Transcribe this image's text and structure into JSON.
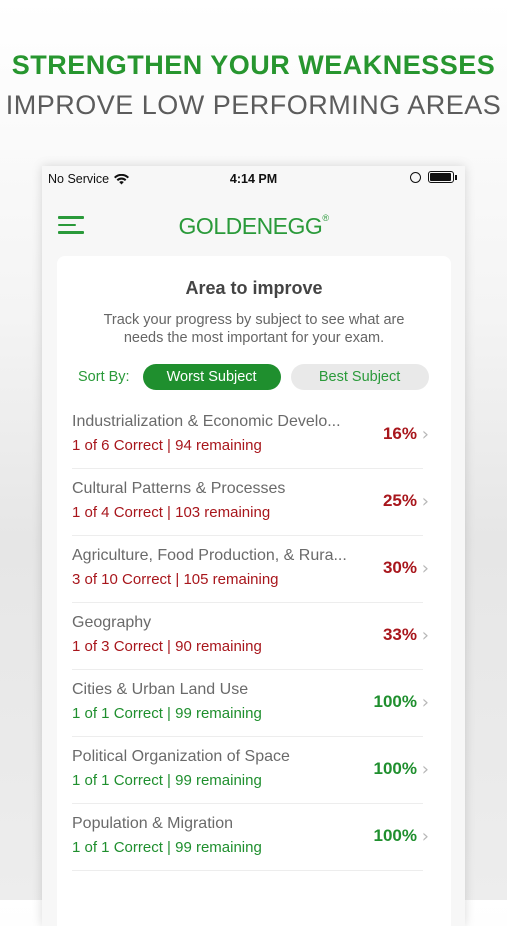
{
  "promo": {
    "title": "STRENGTHEN YOUR WEAKNESSES",
    "subtitle": "IMPROVE LOW PERFORMING AREAS"
  },
  "status_bar": {
    "carrier": "No Service",
    "time": "4:14 PM"
  },
  "header": {
    "logo": "GOLDENEGG",
    "logo_mark": "®"
  },
  "card": {
    "title": "Area to improve",
    "description": "Track your progress by subject to see what are needs the most important for your exam.",
    "sort_label": "Sort By:",
    "sort_worst": "Worst Subject",
    "sort_best": "Best Subject"
  },
  "subjects": [
    {
      "name": "Industrialization & Economic Develo...",
      "meta": "1 of 6  Correct | 94 remaining",
      "percent": "16%",
      "status": "red"
    },
    {
      "name": "Cultural Patterns & Processes",
      "meta": "1 of 4  Correct | 103 remaining",
      "percent": "25%",
      "status": "red"
    },
    {
      "name": "Agriculture, Food Production, & Rura...",
      "meta": "3 of 10  Correct | 105 remaining",
      "percent": "30%",
      "status": "red"
    },
    {
      "name": "Geography",
      "meta": "1 of 3  Correct | 90 remaining",
      "percent": "33%",
      "status": "red"
    },
    {
      "name": "Cities & Urban Land Use",
      "meta": "1 of 1  Correct | 99 remaining",
      "percent": "100%",
      "status": "green"
    },
    {
      "name": "Political Organization of Space",
      "meta": "1 of 1  Correct | 99 remaining",
      "percent": "100%",
      "status": "green"
    },
    {
      "name": "Population & Migration",
      "meta": "1 of 1  Correct | 99 remaining",
      "percent": "100%",
      "status": "green"
    }
  ],
  "colors": {
    "brand_green": "#1f8f2e",
    "low_score_red": "#a8161c"
  },
  "icons": {
    "menu": "hamburger-menu-icon",
    "chevron": "chevron-right-icon",
    "wifi": "wifi-icon",
    "battery": "battery-icon"
  }
}
